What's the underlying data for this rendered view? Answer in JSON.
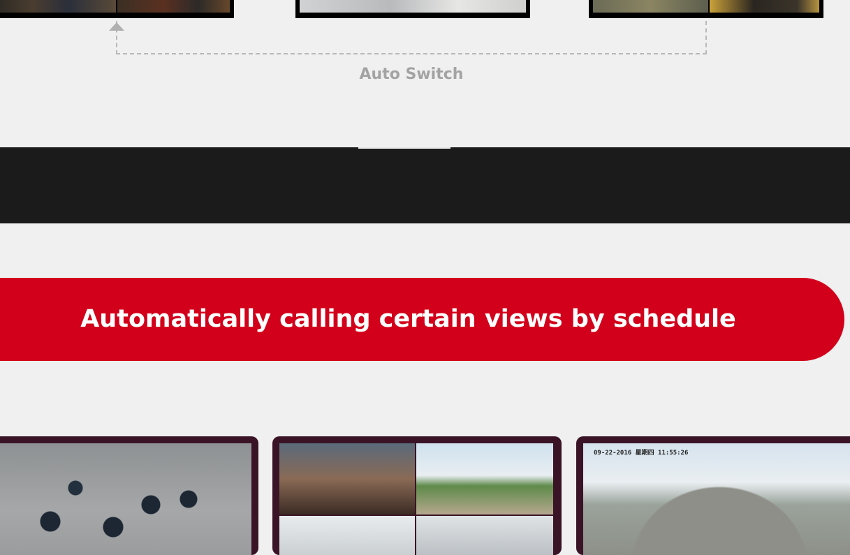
{
  "auto_switch": {
    "label": "Auto Switch"
  },
  "schedule_banner": {
    "text": "Automatically calling certain views by schedule"
  },
  "camera_overlay": {
    "timestamp": "09-22-2016 星期四 11:55:26"
  },
  "colors": {
    "background": "#f0f0f0",
    "dark_band": "#1b1b1b",
    "accent_red": "#d2001b",
    "card_frame": "#3a1426",
    "label_gray": "#a3a3a3"
  }
}
